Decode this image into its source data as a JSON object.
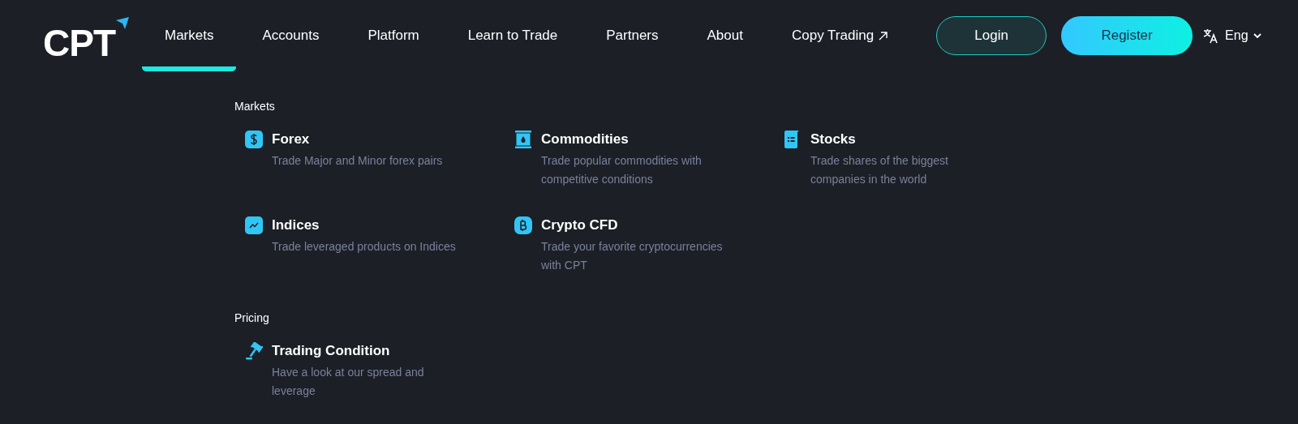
{
  "nav": {
    "logo": "CPT",
    "items": [
      {
        "label": "Markets",
        "selected": true,
        "external": false
      },
      {
        "label": "Accounts",
        "selected": false,
        "external": false
      },
      {
        "label": "Platform",
        "selected": false,
        "external": false
      },
      {
        "label": "Learn to Trade",
        "selected": false,
        "external": false
      },
      {
        "label": "Partners",
        "selected": false,
        "external": false
      },
      {
        "label": "About",
        "selected": false,
        "external": false
      },
      {
        "label": "Copy Trading",
        "selected": false,
        "external": true
      }
    ],
    "login": "Login",
    "register": "Register",
    "language": "Eng"
  },
  "menu": [
    {
      "heading": "Markets",
      "items": [
        {
          "kind": "forex",
          "title": "Forex",
          "description": "Trade Major and Minor forex pairs"
        },
        {
          "kind": "commodities",
          "title": "Commodities",
          "description": "Trade popular commodities with competitive conditions"
        },
        {
          "kind": "stocks",
          "title": "Stocks",
          "description": "Trade shares of the biggest companies in the world"
        },
        {
          "kind": "indices",
          "title": "Indices",
          "description": "Trade leveraged products on Indices"
        },
        {
          "kind": "crypto",
          "title": "Crypto CFD",
          "description": "Trade your favorite cryptocurrencies with CPT"
        }
      ]
    },
    {
      "heading": "Pricing",
      "items": [
        {
          "kind": "pricing",
          "title": "Trading Condition",
          "description": "Have a look at our spread and leverage"
        }
      ]
    }
  ]
}
